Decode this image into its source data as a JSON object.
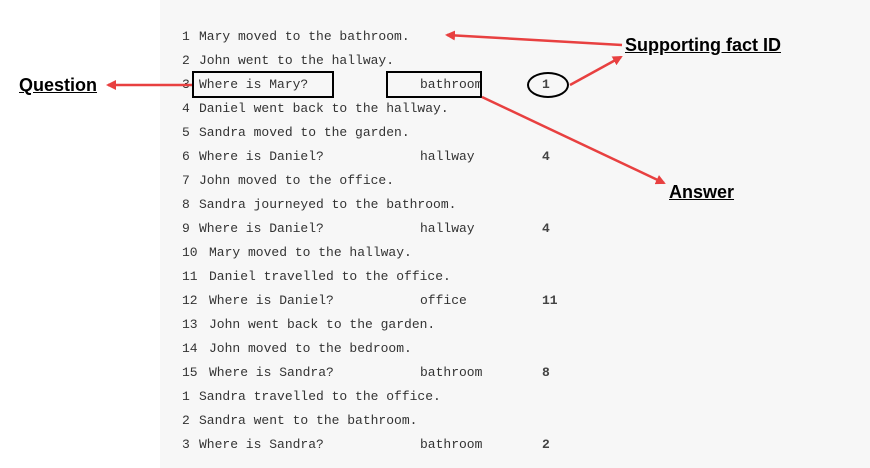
{
  "lines": [
    {
      "num": "1",
      "text": "Mary moved to the bathroom."
    },
    {
      "num": "2",
      "text": "John went to the hallway."
    },
    {
      "num": "3",
      "text": "Where is Mary?",
      "answer": "bathroom",
      "support": "1"
    },
    {
      "num": "4",
      "text": "Daniel went back to the hallway."
    },
    {
      "num": "5",
      "text": "Sandra moved to the garden."
    },
    {
      "num": "6",
      "text": "Where is Daniel?",
      "answer": "hallway",
      "support": "4"
    },
    {
      "num": "7",
      "text": "John moved to the office."
    },
    {
      "num": "8",
      "text": "Sandra journeyed to the bathroom."
    },
    {
      "num": "9",
      "text": "Where is Daniel?",
      "answer": "hallway",
      "support": "4"
    },
    {
      "num": "10",
      "text": "Mary moved to the hallway."
    },
    {
      "num": "11",
      "text": "Daniel travelled to the office."
    },
    {
      "num": "12",
      "text": "Where is Daniel?",
      "answer": "office",
      "support": "11"
    },
    {
      "num": "13",
      "text": "John went back to the garden."
    },
    {
      "num": "14",
      "text": "John moved to the bedroom."
    },
    {
      "num": "15",
      "text": "Where is Sandra?",
      "answer": "bathroom",
      "support": "8"
    },
    {
      "num": "1",
      "text": "Sandra travelled to the office."
    },
    {
      "num": "2",
      "text": "Sandra went to the bathroom."
    },
    {
      "num": "3",
      "text": "Where is Sandra?",
      "answer": "bathroom",
      "support": "2"
    }
  ],
  "labels": {
    "question": "Question",
    "answer": "Answer",
    "supporting": "Supporting fact ID"
  },
  "colors": {
    "arrow": "#e84040",
    "panel": "#f7f7f7"
  }
}
